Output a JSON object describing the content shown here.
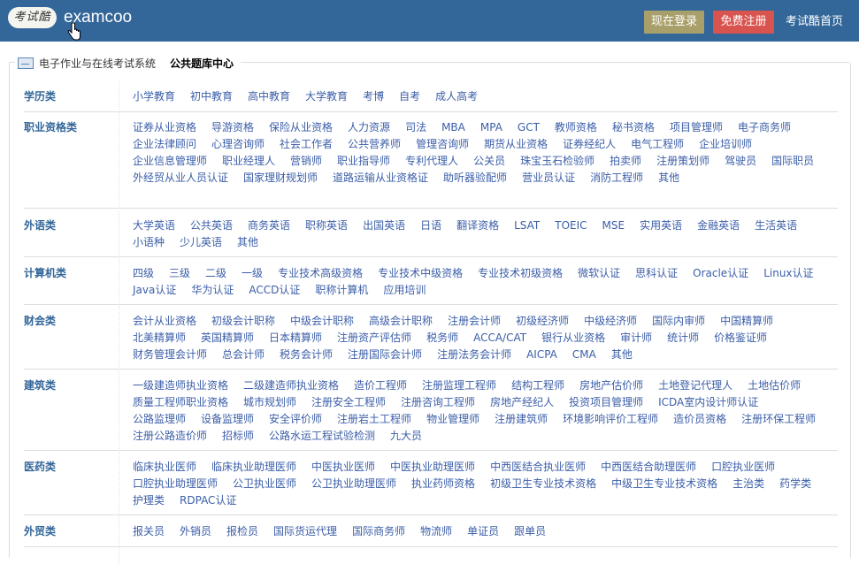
{
  "header": {
    "logo_text": "考试酷",
    "site_name": "examcoo",
    "login_label": "现在登录",
    "register_label": "免费注册",
    "home_label": "考试酷首页"
  },
  "breadcrumb": {
    "system": "电子作业与在线考试系统",
    "current": "公共题库中心"
  },
  "categories": [
    {
      "title": "学历类",
      "items": [
        "小学教育",
        "初中教育",
        "高中教育",
        "大学教育",
        "考博",
        "自考",
        "成人高考"
      ]
    },
    {
      "title": "职业资格类",
      "items": [
        "证券从业资格",
        "导游资格",
        "保险从业资格",
        "人力资源",
        "司法",
        "MBA",
        "MPA",
        "GCT",
        "教师资格",
        "秘书资格",
        "项目管理师",
        "电子商务师",
        "企业法律顾问",
        "心理咨询师",
        "社会工作者",
        "公共营养师",
        "管理咨询师",
        "期货从业资格",
        "证券经纪人",
        "电气工程师",
        "企业培训师",
        "企业信息管理师",
        "职业经理人",
        "营销师",
        "职业指导师",
        "专利代理人",
        "公关员",
        "珠宝玉石检验师",
        "拍卖师",
        "注册策划师",
        "驾驶员",
        "国际职员",
        "外经贸从业人员认证",
        "国家理财规划师",
        "道路运输从业资格证",
        "助听器验配师",
        "营业员认证",
        "消防工程师",
        "其他"
      ]
    },
    {
      "title": "外语类",
      "items": [
        "大学英语",
        "公共英语",
        "商务英语",
        "职称英语",
        "出国英语",
        "日语",
        "翻译资格",
        "LSAT",
        "TOEIC",
        "MSE",
        "实用英语",
        "金融英语",
        "生活英语",
        "小语种",
        "少儿英语",
        "其他"
      ]
    },
    {
      "title": "计算机类",
      "items": [
        "四级",
        "三级",
        "二级",
        "一级",
        "专业技术高级资格",
        "专业技术中级资格",
        "专业技术初级资格",
        "微软认证",
        "思科认证",
        "Oracle认证",
        "Linux认证",
        "Java认证",
        "华为认证",
        "ACCD认证",
        "职称计算机",
        "应用培训"
      ]
    },
    {
      "title": "财会类",
      "items": [
        "会计从业资格",
        "初级会计职称",
        "中级会计职称",
        "高级会计职称",
        "注册会计师",
        "初级经济师",
        "中级经济师",
        "国际内审师",
        "中国精算师",
        "北美精算师",
        "英国精算师",
        "日本精算师",
        "注册资产评估师",
        "税务师",
        "ACCA/CAT",
        "银行从业资格",
        "审计师",
        "统计师",
        "价格鉴证师",
        "财务管理会计师",
        "总会计师",
        "税务会计师",
        "注册国际会计师",
        "注册法务会计师",
        "AICPA",
        "CMA",
        "其他"
      ]
    },
    {
      "title": "建筑类",
      "items": [
        "一级建造师执业资格",
        "二级建造师执业资格",
        "造价工程师",
        "注册监理工程师",
        "结构工程师",
        "房地产估价师",
        "土地登记代理人",
        "土地估价师",
        "质量工程师职业资格",
        "城市规划师",
        "注册安全工程师",
        "注册咨询工程师",
        "房地产经纪人",
        "投资项目管理师",
        "ICDA室内设计师认证",
        "公路监理师",
        "设备监理师",
        "安全评价师",
        "注册岩土工程师",
        "物业管理师",
        "注册建筑师",
        "环境影响评价工程师",
        "造价员资格",
        "注册环保工程师",
        "注册公路造价师",
        "招标师",
        "公路水运工程试验检测",
        "九大员"
      ]
    },
    {
      "title": "医药类",
      "items": [
        "临床执业医师",
        "临床执业助理医师",
        "中医执业医师",
        "中医执业助理医师",
        "中西医结合执业医师",
        "中西医结合助理医师",
        "口腔执业医师",
        "口腔执业助理医师",
        "公卫执业医师",
        "公卫执业助理医师",
        "执业药师资格",
        "初级卫生专业技术资格",
        "中级卫生专业技术资格",
        "主治类",
        "药学类",
        "护理类",
        "RDPAC认证"
      ]
    },
    {
      "title": "外贸类",
      "items": [
        "报关员",
        "外销员",
        "报检员",
        "国际货运代理",
        "国际商务师",
        "物流师",
        "单证员",
        "跟单员"
      ]
    },
    {
      "title": "",
      "items": []
    }
  ]
}
